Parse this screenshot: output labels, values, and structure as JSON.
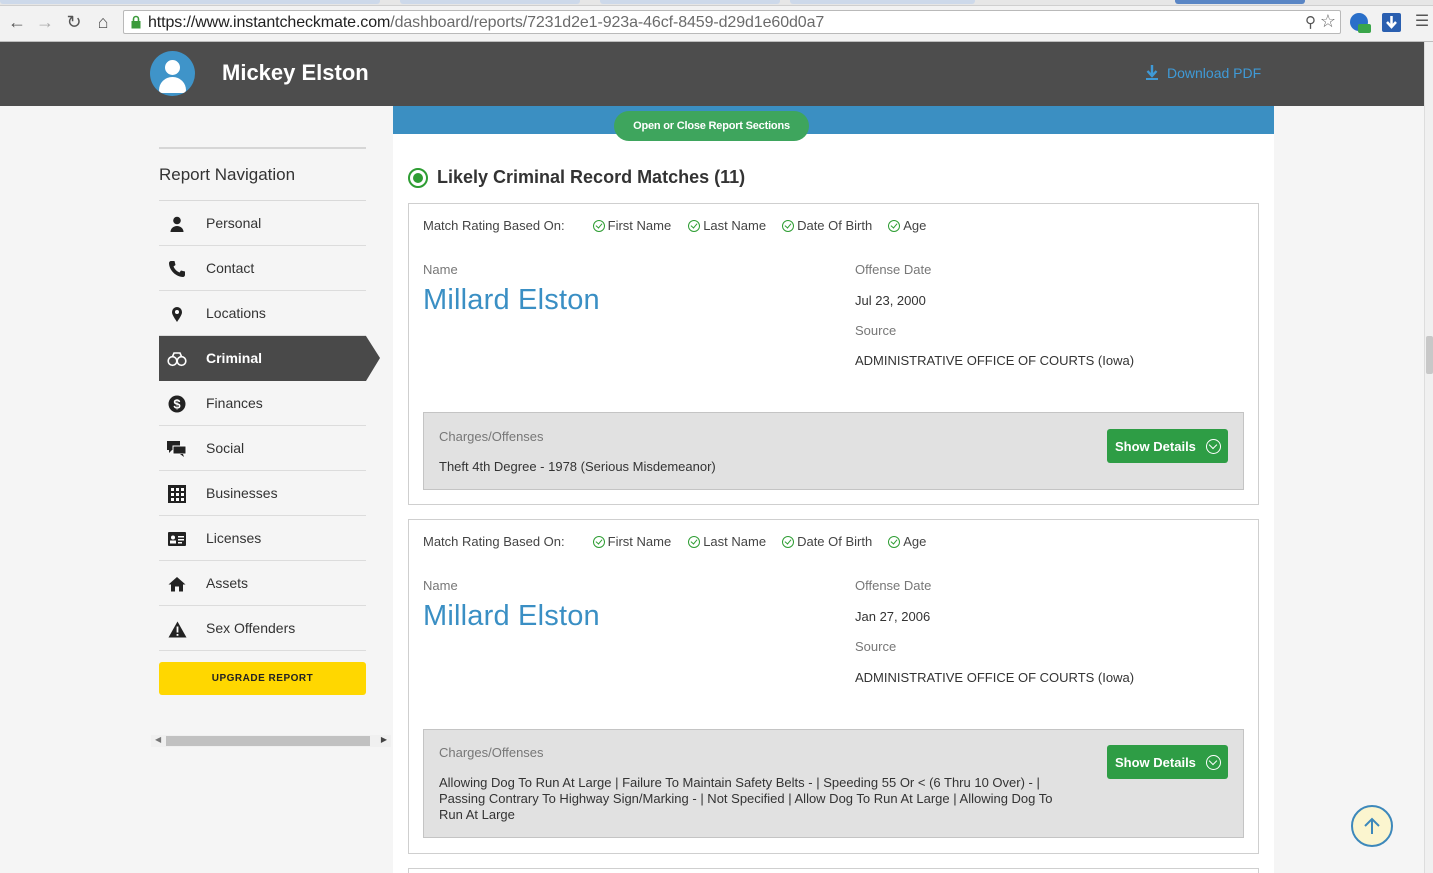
{
  "browser": {
    "url_host": "https://www.instantcheckmate.com",
    "url_path": "/dashboard/reports/7231d2e1-923a-46cf-8459-d29d1e60d0a7"
  },
  "header": {
    "name": "Mickey Elston",
    "download_label": "Download PDF"
  },
  "sidebar": {
    "title": "Report Navigation",
    "items": [
      {
        "label": "Personal",
        "icon": "person-icon"
      },
      {
        "label": "Contact",
        "icon": "phone-icon"
      },
      {
        "label": "Locations",
        "icon": "map-pin-icon"
      },
      {
        "label": "Criminal",
        "icon": "handcuffs-icon",
        "active": true
      },
      {
        "label": "Finances",
        "icon": "dollar-icon"
      },
      {
        "label": "Social",
        "icon": "chat-icon"
      },
      {
        "label": "Businesses",
        "icon": "grid-icon"
      },
      {
        "label": "Licenses",
        "icon": "id-card-icon"
      },
      {
        "label": "Assets",
        "icon": "house-icon"
      },
      {
        "label": "Sex Offenders",
        "icon": "warning-icon"
      }
    ],
    "upgrade_label": "UPGRADE REPORT"
  },
  "main": {
    "toggle_label": "Open or Close Report Sections",
    "section_title": "Likely Criminal Record Matches",
    "section_count": "(11)",
    "match_label": "Match Rating Based On:",
    "criteria": [
      "First Name",
      "Last Name",
      "Date Of Birth",
      "Age"
    ],
    "name_label": "Name",
    "offense_date_label": "Offense Date",
    "source_label": "Source",
    "charges_label": "Charges/Offenses",
    "show_details_label": "Show Details",
    "records": [
      {
        "name": "Millard Elston",
        "offense_date": "Jul 23, 2000",
        "source": "ADMINISTRATIVE OFFICE OF COURTS (Iowa)",
        "charges": "Theft 4th Degree - 1978 (Serious Misdemeanor)"
      },
      {
        "name": "Millard Elston",
        "offense_date": "Jan 27, 2006",
        "source": "ADMINISTRATIVE OFFICE OF COURTS (Iowa)",
        "charges": "Allowing Dog To Run At Large | Failure To Maintain Safety Belts - | Speeding 55 Or < (6 Thru 10 Over) - | Passing Contrary To Highway Sign/Marking - | Not Specified | Allow Dog To Run At Large | Allowing Dog To Run At Large"
      }
    ]
  },
  "colors": {
    "header_bg": "#4d4d4d",
    "accent_blue": "#3a8fc4",
    "green": "#2e9d45",
    "upgrade_yellow": "#ffd700"
  }
}
